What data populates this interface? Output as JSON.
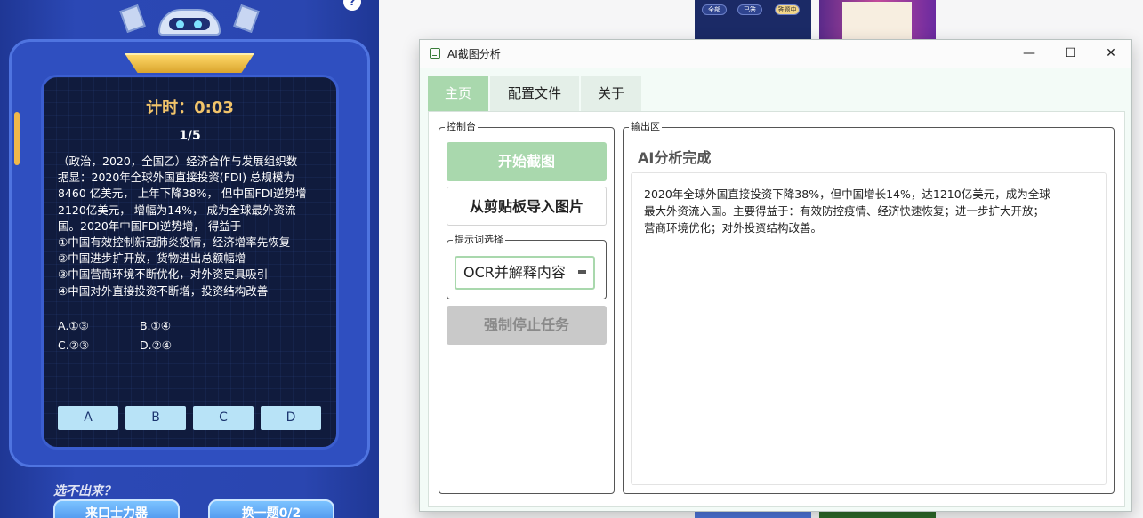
{
  "game": {
    "timer": "计时：0:03",
    "progress": "1/5",
    "question_lines": [
      "（政治，2020，全国乙）经济合作与发展组织数",
      "据显：2020年全球外国直接投资(FDI) 总规模为",
      "8460 亿美元， 上年下降38%， 但中国FDI逆势增",
      "2120亿美元， 增幅为14%， 成为全球最外资流",
      "国。2020年中国FDI逆势增， 得益于",
      "①中国有效控制新冠肺炎疫情，经济增率先恢复",
      "②中国进步扩开放，货物进出总额幅增",
      "③中国营商环境不断优化，对外资更具吸引",
      "④中国对外直接投资不断增，投资结构改善"
    ],
    "options": [
      "A.①③",
      "B.①④",
      "C.②③",
      "D.②④"
    ],
    "answer_buttons": [
      "A",
      "B",
      "C",
      "D"
    ],
    "hint": "选不出来？",
    "bottom_buttons": [
      "来口士力器",
      "换一题0/2"
    ]
  },
  "thumbnail": {
    "pills": [
      "全部",
      "已答",
      "答题中"
    ]
  },
  "window": {
    "title": "AI截图分析",
    "controls": {
      "minimize": "—",
      "maximize": "☐",
      "close": "✕"
    },
    "tabs": [
      "主页",
      "配置文件",
      "关于"
    ],
    "active_tab": "主页",
    "console": {
      "label": "控制台",
      "start_button": "开始截图",
      "import_button": "从剪贴板导入图片",
      "prompt_label": "提示词选择",
      "prompt_value": "OCR并解释内容",
      "stop_button": "强制停止任务"
    },
    "output": {
      "label": "输出区",
      "heading": "AI分析完成",
      "lines": [
        "2020年全球外国直接投资下降38%，但中国增长14%，达1210亿美元，成为全球",
        "最大外资流入国。主要得益于：有效防控疫情、经济快速恢复；进一步扩大开放；",
        "营商环境优化；对外投资结构改善。"
      ]
    }
  },
  "colors": {
    "accent_green": "#a9d8ad",
    "game_blue": "#2540a8",
    "timer_gold": "#f2c46a",
    "answer_button": "#b8e3f7"
  }
}
